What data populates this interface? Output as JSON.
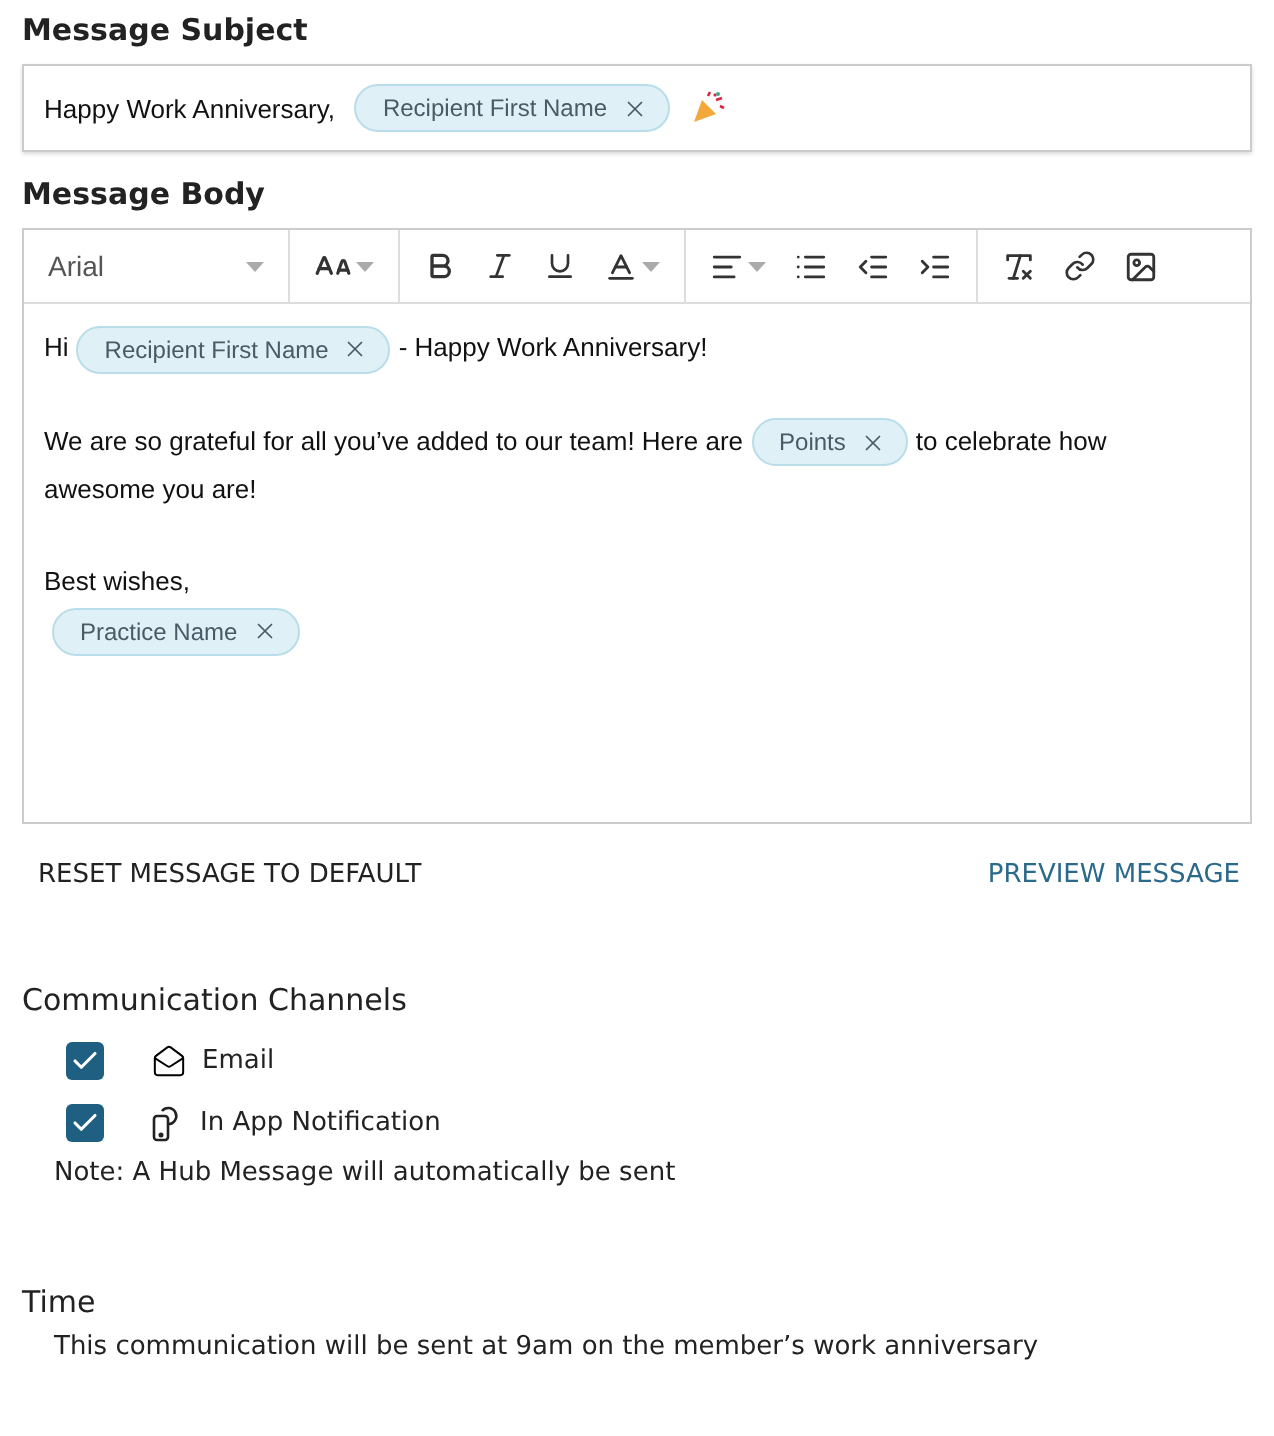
{
  "subject": {
    "label": "Message Subject",
    "segments": [
      {
        "kind": "text",
        "text": "Happy Work Anniversary,"
      },
      {
        "kind": "tag",
        "text": "Recipient First Name"
      },
      {
        "kind": "emoji"
      }
    ]
  },
  "body": {
    "label": "Message Body",
    "font": "Arial",
    "paragraphs": [
      [
        {
          "kind": "text",
          "text": "Hi"
        },
        {
          "kind": "tag",
          "text": "Recipient First Name"
        },
        {
          "kind": "text",
          "text": "- Happy Work Anniversary!"
        }
      ],
      [
        {
          "kind": "text",
          "text": "We are so grateful for all you’ve added to our team! Here are"
        },
        {
          "kind": "tag",
          "text": "Points"
        },
        {
          "kind": "text",
          "text": "to celebrate how"
        },
        {
          "kind": "break"
        },
        {
          "kind": "text",
          "text": "awesome you are!"
        }
      ],
      [
        {
          "kind": "text",
          "text": "Best wishes,"
        },
        {
          "kind": "break"
        },
        {
          "kind": "tag",
          "text": "Practice Name"
        }
      ]
    ]
  },
  "actions": {
    "reset": "RESET MESSAGE TO DEFAULT",
    "preview": "PREVIEW MESSAGE"
  },
  "channels": {
    "label": "Communication Channels",
    "items": [
      {
        "kind": "email",
        "label": "Email",
        "checked": true
      },
      {
        "kind": "app",
        "label": "In App Notification",
        "checked": true
      }
    ],
    "note": "Note: A Hub Message will automatically be sent"
  },
  "time": {
    "label": "Time",
    "text": "This communication will be sent at 9am on the member’s work anniversary"
  }
}
